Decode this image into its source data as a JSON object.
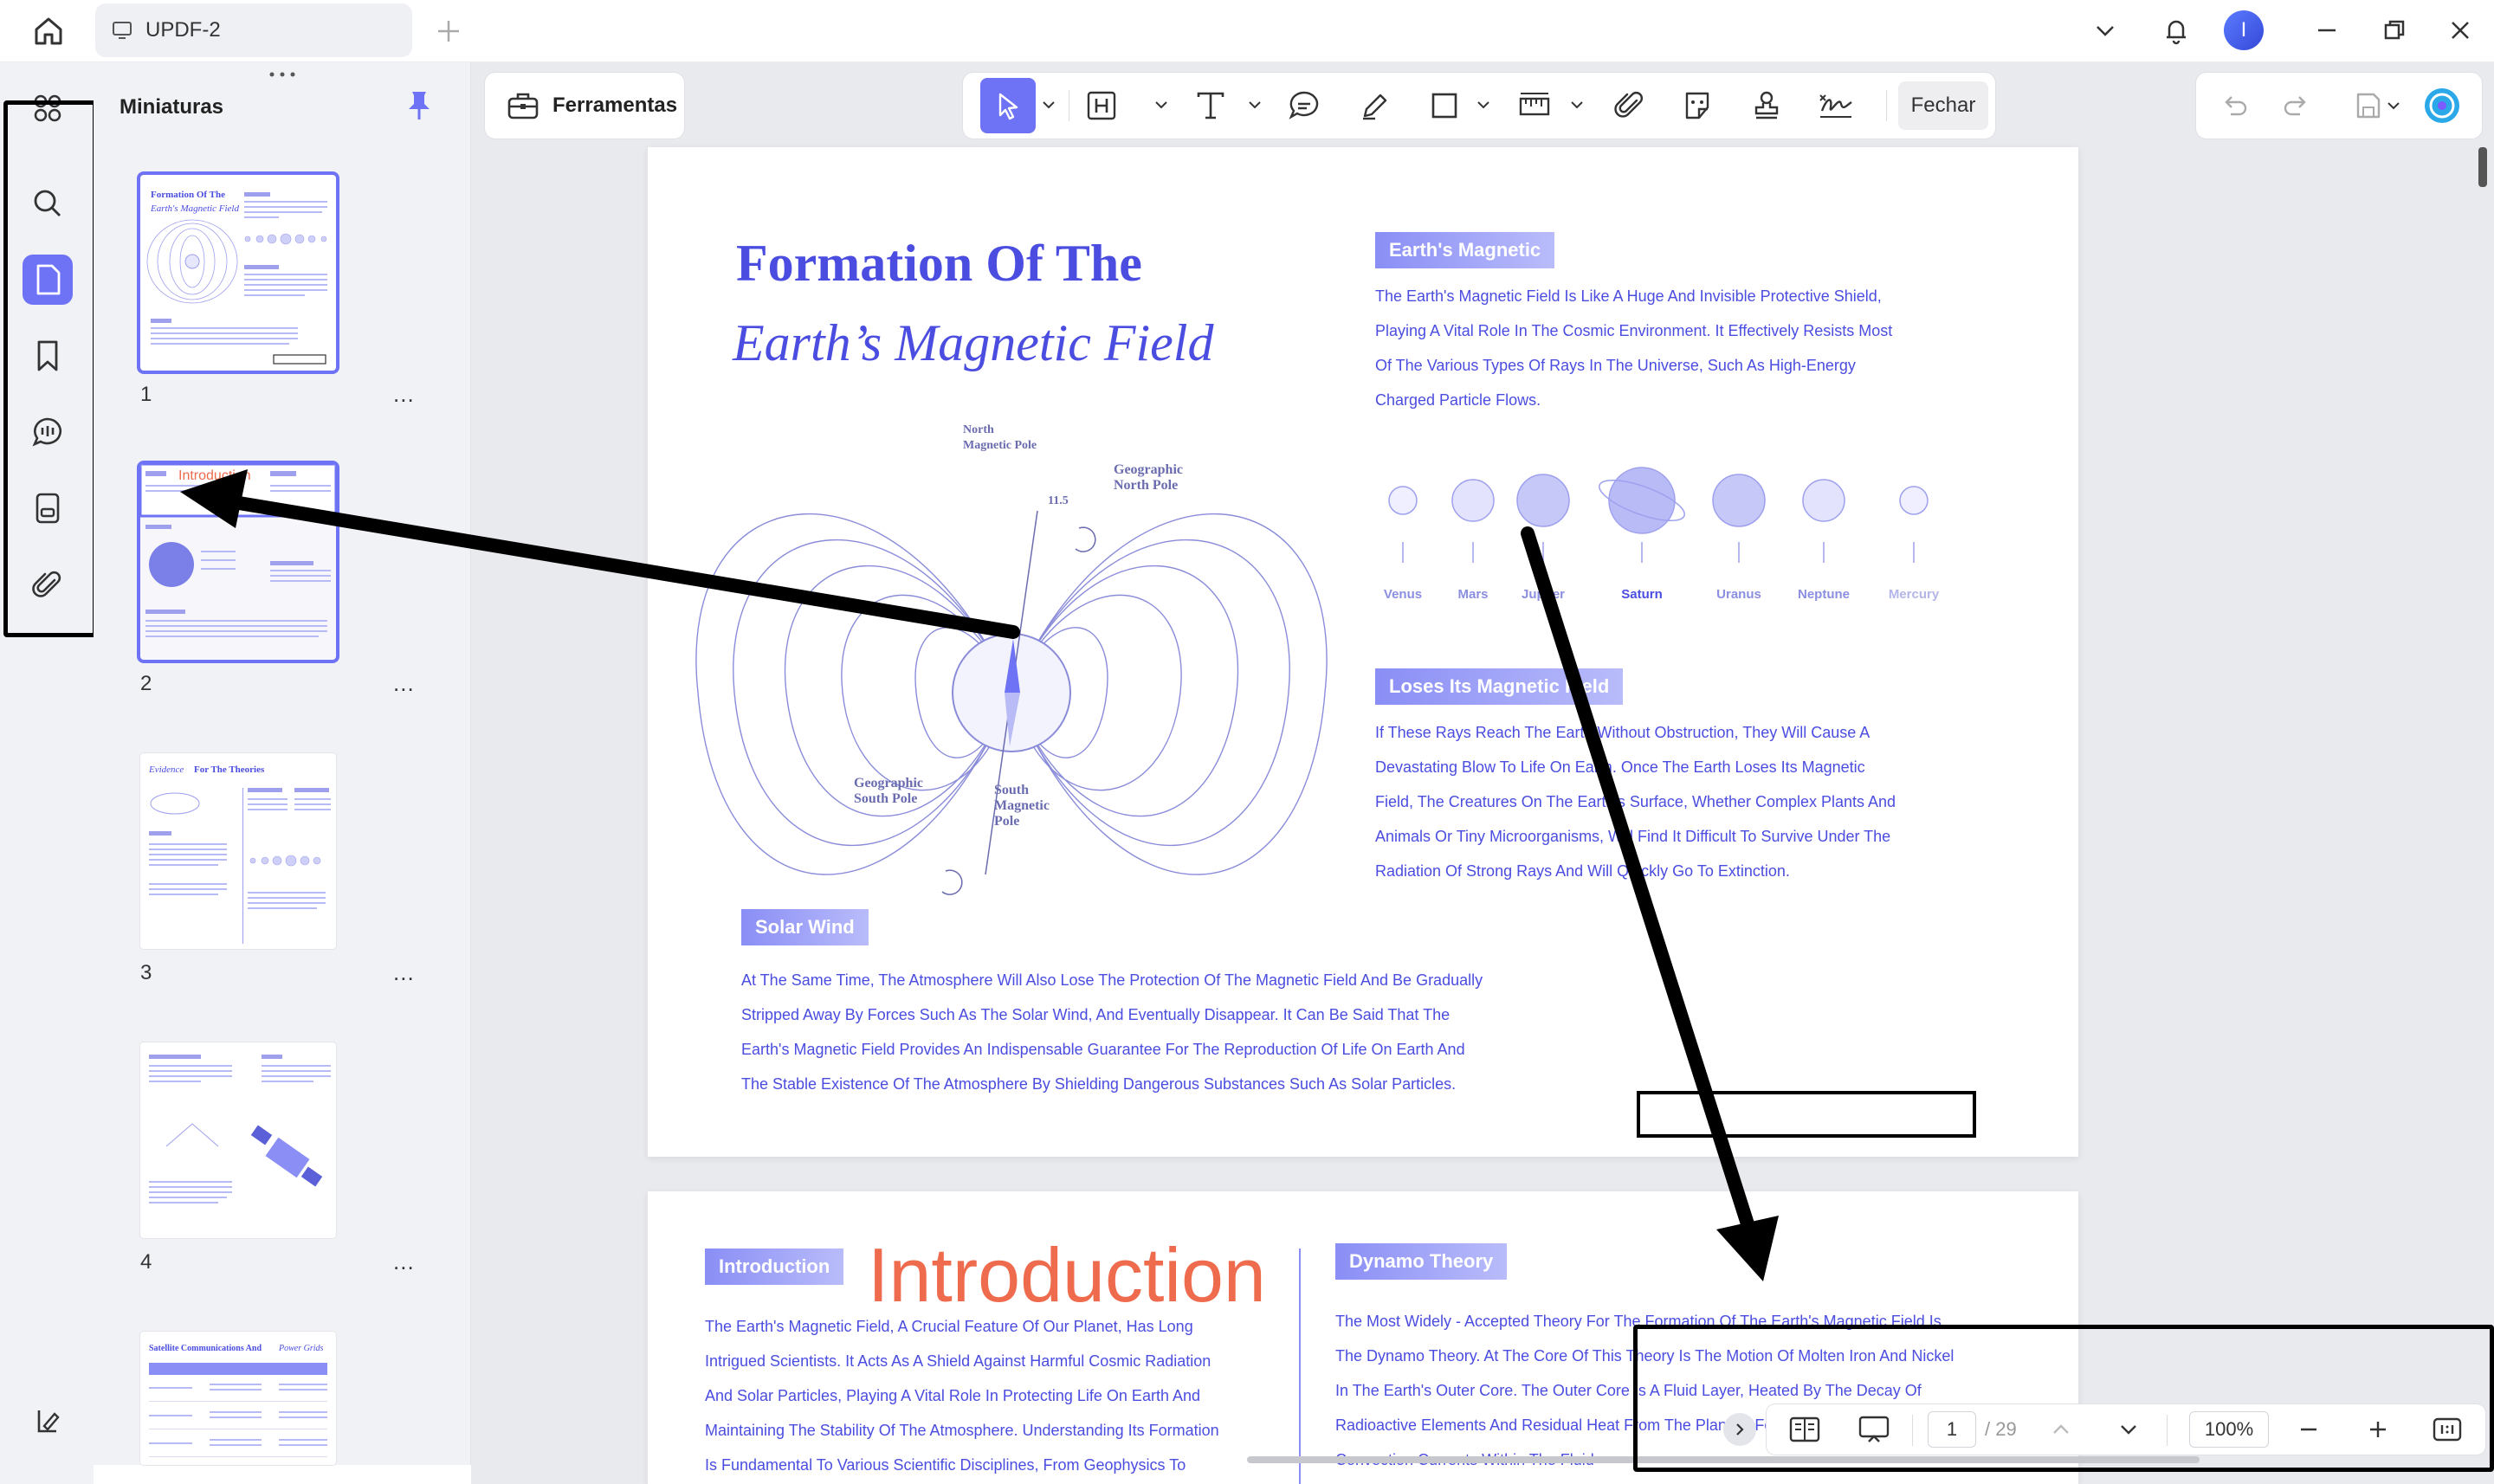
{
  "titlebar": {
    "tab_title": "UPDF-2",
    "avatar_initial": "I"
  },
  "panel": {
    "title": "Miniaturas",
    "thumbnails": [
      {
        "number": "1",
        "more": "..."
      },
      {
        "number": "2",
        "more": "...",
        "heading": "Introduction"
      },
      {
        "number": "3",
        "more": "...",
        "heading_a": "Evidence",
        "heading_b": "For The Theories"
      },
      {
        "number": "4",
        "more": "..."
      },
      {
        "number": "5",
        "heading_a": "Satellite Communications And",
        "heading_b": "Power Grids"
      }
    ]
  },
  "toolbar": {
    "tools_label": "Ferramentas",
    "close_label": "Fechar"
  },
  "page1": {
    "title_line1": "Formation Of The",
    "title_line2": "Earth’s Magnetic Field",
    "tag_magnetic": "Earth's Magnetic",
    "magnetic_text": [
      "The Earth's Magnetic Field Is Like A Huge And Invisible Protective Shield,",
      "Playing A Vital Role In The Cosmic Environment. It Effectively Resists Most",
      "Of The Various Types Of Rays In The Universe, Such As High-Energy",
      "Charged Particle Flows."
    ],
    "planets": [
      "Venus",
      "Mars",
      "Jupiter",
      "Saturn",
      "Uranus",
      "Neptune",
      "Mercury"
    ],
    "tag_loses": "Loses Its Magnetic Field",
    "loses_text": [
      "If These Rays Reach The Earth Without Obstruction, They Will Cause A",
      "Devastating Blow To Life On Earth. Once The Earth Loses Its Magnetic",
      "Field, The Creatures On The Earth's Surface, Whether Complex Plants And",
      "Animals Or Tiny Microorganisms, Will Find It Difficult To Survive Under The",
      "Radiation Of Strong Rays And Will Quickly Go To Extinction."
    ],
    "tag_solar": "Solar Wind",
    "solar_text": [
      "At The Same Time, The Atmosphere Will Also Lose The Protection Of The Magnetic Field And Be Gradually",
      "Stripped Away By Forces Such As The Solar Wind, And Eventually Disappear. It Can Be Said That The",
      "Earth's Magnetic Field Provides An Indispensable Guarantee For The Reproduction Of Life On Earth And",
      "The Stable Existence Of The Atmosphere By Shielding Dangerous Substances Such As Solar Particles."
    ],
    "field_labels": {
      "north_magnetic": [
        "North",
        "Magnetic Pole"
      ],
      "geo_north": [
        "Geographic",
        "North Pole"
      ],
      "angle": "11.5",
      "geo_south": [
        "Geographic",
        "South Pole"
      ],
      "south_magnetic": [
        "South",
        "Magnetic",
        "Pole"
      ]
    }
  },
  "page2": {
    "tag_intro": "Introduction",
    "intro_big": "Introduction",
    "intro_text": [
      "The Earth's Magnetic Field, A Crucial Feature Of Our Planet, Has Long",
      "Intrigued Scientists. It Acts As A Shield Against Harmful Cosmic Radiation",
      "And Solar Particles, Playing A Vital Role In Protecting Life On Earth And",
      "Maintaining The Stability Of The Atmosphere. Understanding Its Formation",
      "Is Fundamental To Various Scientific Disciplines, From Geophysics To"
    ],
    "tag_dynamo": "Dynamo Theory",
    "dynamo_text": [
      "The Most Widely - Accepted Theory For The Formation Of The Earth's Magnetic Field Is",
      "The Dynamo Theory. At The Core Of This Theory Is The Motion Of Molten Iron And Nickel",
      "In The Earth's Outer Core. The Outer Core Is A Fluid Layer, Heated By The Decay Of",
      "Radioactive Elements And Residual Heat From The Planet's Formation. The Heat Causes",
      "Convection Currents Within The Fluid"
    ]
  },
  "bottom_bar": {
    "current_page": "1",
    "total_pages": "/ 29",
    "zoom": "100%"
  },
  "colors": {
    "accent": "#6e72f5",
    "doc_blue": "#4b4de0",
    "doc_orange": "#ef6b4e"
  }
}
